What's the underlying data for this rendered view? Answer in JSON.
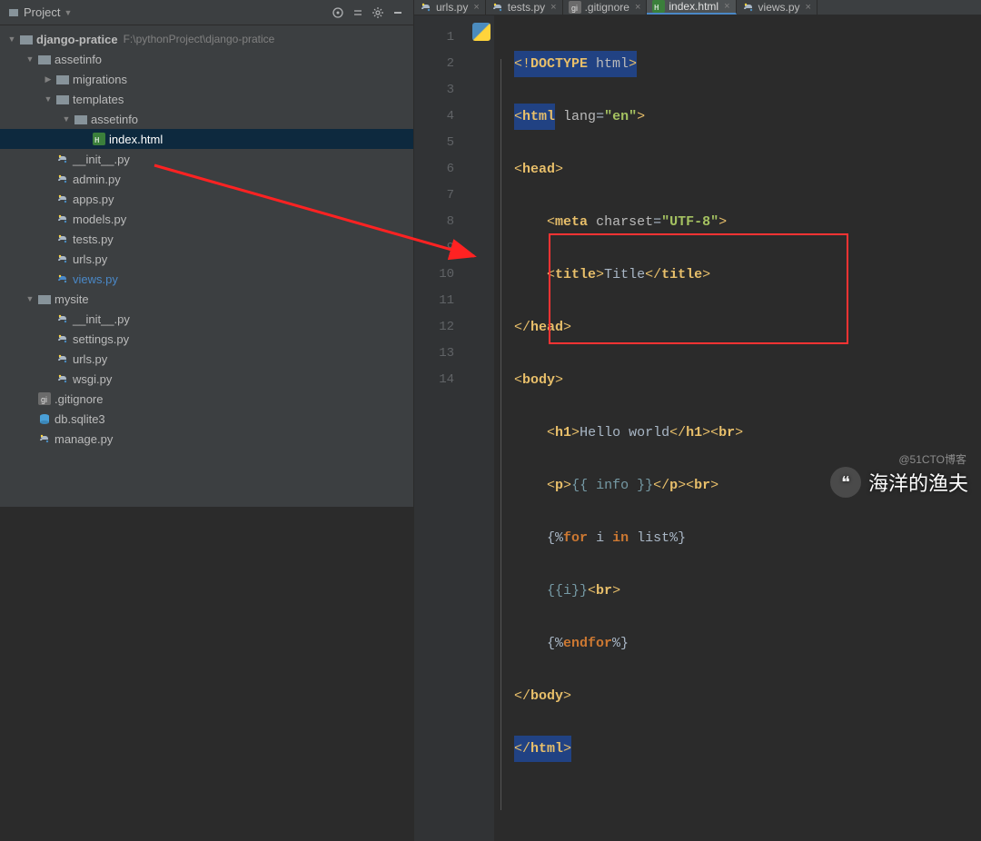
{
  "sidebar": {
    "title": "Project",
    "tree": {
      "root": {
        "label": "django-pratice",
        "path": "F:\\pythonProject\\django-pratice"
      },
      "items": [
        {
          "indent": 1,
          "arrow": "down",
          "icon": "folder",
          "label": "assetinfo"
        },
        {
          "indent": 2,
          "arrow": "right",
          "icon": "folder",
          "label": "migrations"
        },
        {
          "indent": 2,
          "arrow": "down",
          "icon": "folder",
          "label": "templates"
        },
        {
          "indent": 3,
          "arrow": "down",
          "icon": "folder",
          "label": "assetinfo"
        },
        {
          "indent": 4,
          "arrow": "",
          "icon": "html",
          "label": "index.html",
          "selected": true
        },
        {
          "indent": 2,
          "arrow": "",
          "icon": "py",
          "label": "__init__.py"
        },
        {
          "indent": 2,
          "arrow": "",
          "icon": "py",
          "label": "admin.py"
        },
        {
          "indent": 2,
          "arrow": "",
          "icon": "py",
          "label": "apps.py"
        },
        {
          "indent": 2,
          "arrow": "",
          "icon": "py",
          "label": "models.py"
        },
        {
          "indent": 2,
          "arrow": "",
          "icon": "py",
          "label": "tests.py"
        },
        {
          "indent": 2,
          "arrow": "",
          "icon": "py",
          "label": "urls.py"
        },
        {
          "indent": 2,
          "arrow": "",
          "icon": "py",
          "label": "views.py",
          "modified": true
        },
        {
          "indent": 1,
          "arrow": "down",
          "icon": "folder",
          "label": "mysite"
        },
        {
          "indent": 2,
          "arrow": "",
          "icon": "py",
          "label": "__init__.py"
        },
        {
          "indent": 2,
          "arrow": "",
          "icon": "py",
          "label": "settings.py"
        },
        {
          "indent": 2,
          "arrow": "",
          "icon": "py",
          "label": "urls.py"
        },
        {
          "indent": 2,
          "arrow": "",
          "icon": "py",
          "label": "wsgi.py"
        },
        {
          "indent": 1,
          "arrow": "",
          "icon": "git",
          "label": ".gitignore"
        },
        {
          "indent": 1,
          "arrow": "",
          "icon": "db",
          "label": "db.sqlite3"
        },
        {
          "indent": 1,
          "arrow": "",
          "icon": "py",
          "label": "manage.py"
        }
      ]
    }
  },
  "tabs": [
    {
      "icon": "py",
      "label": "urls.py"
    },
    {
      "icon": "py",
      "label": "tests.py"
    },
    {
      "icon": "git",
      "label": ".gitignore"
    },
    {
      "icon": "html",
      "label": "index.html",
      "active": true
    },
    {
      "icon": "py",
      "label": "views.py"
    }
  ],
  "editor": {
    "lines": [
      "1",
      "2",
      "3",
      "4",
      "5",
      "6",
      "7",
      "8",
      "9",
      "10",
      "11",
      "12",
      "13",
      "14"
    ],
    "code": {
      "l1": "<!DOCTYPE html>",
      "l2_tag": "html",
      "l2_attr": "lang",
      "l2_val": "\"en\"",
      "l3": "head",
      "l4_tag": "meta",
      "l4_attr": "charset",
      "l4_val": "\"UTF-8\"",
      "l5_tag": "title",
      "l5_txt": "Title",
      "l6": "head",
      "l7": "body",
      "l8_tag": "h1",
      "l8_txt": "Hello world",
      "l8_br": "br",
      "l9_tag": "p",
      "l9_var": "{{ info }}",
      "l9_br": "br",
      "l10_for": "for",
      "l10_i": "i",
      "l10_in": "in",
      "l10_list": "list",
      "l11_var": "{{i}}",
      "l11_br": "br",
      "l12_end": "endfor",
      "l13": "body",
      "l14": "html"
    }
  },
  "watermark": {
    "main": "海洋的渔夫",
    "sub": "@51CTO博客"
  }
}
